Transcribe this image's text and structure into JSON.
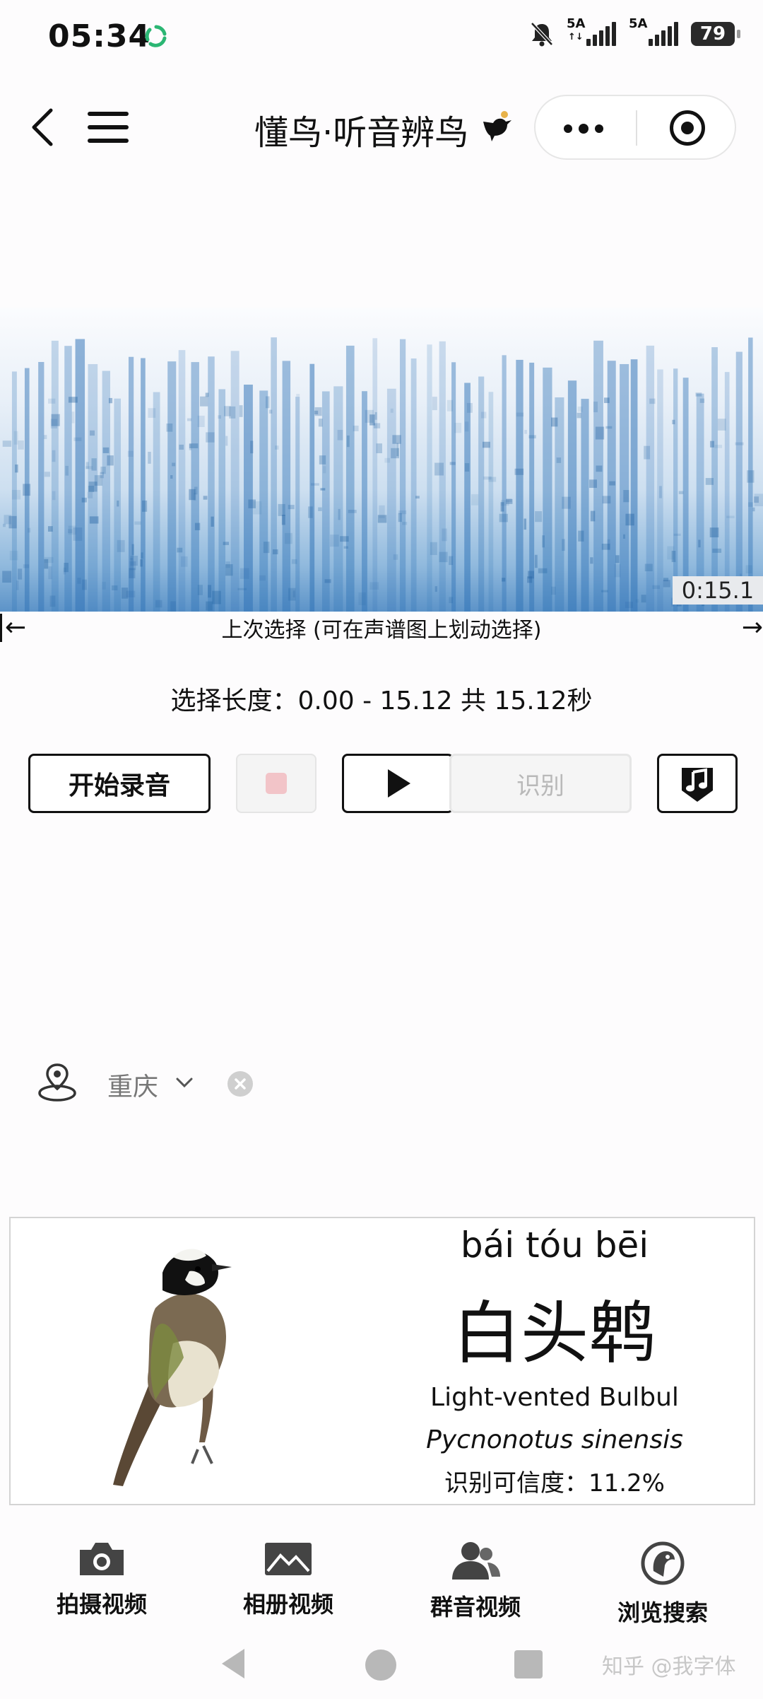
{
  "status_bar": {
    "time": "05:34",
    "sync_icon": "sync-icon",
    "mute_icon": "bell-off-icon",
    "signal_1_label": "5A",
    "signal_2_label": "5A",
    "battery": "79"
  },
  "nav": {
    "back_icon": "chevron-left-icon",
    "menu_icon": "hamburger-menu-icon",
    "title": "懂鸟·听音辨鸟",
    "title_icon": "bird-icon",
    "more_icon": "more-dots-icon",
    "close_icon": "target-circle-icon"
  },
  "spectrogram": {
    "time_label": "0:15.1",
    "left_arrow": "←",
    "right_arrow": "→",
    "hint": "上次选择 (可在声谱图上划动选择)"
  },
  "selection": {
    "text": "选择长度：0.00 - 15.12 共 15.12秒"
  },
  "controls": {
    "record_label": "开始录音",
    "stop_icon": "stop-icon",
    "play_icon": "play-icon",
    "identify_label": "识别",
    "music_icon": "music-download-icon"
  },
  "location": {
    "icon": "location-pin-icon",
    "city": "重庆",
    "chevron_icon": "chevron-down-icon",
    "clear_icon": "clear-circle-icon"
  },
  "result": {
    "pinyin": "bái tóu bēi",
    "chinese_name": "白头鹎",
    "english_name": "Light-vented Bulbul",
    "scientific_name": "Pycnonotus sinensis",
    "confidence": "识别可信度：11.2%"
  },
  "tabs": [
    {
      "label": "拍摄视频",
      "icon": "camera-icon"
    },
    {
      "label": "相册视频",
      "icon": "image-icon"
    },
    {
      "label": "群音视频",
      "icon": "users-icon"
    },
    {
      "label": "浏览搜索",
      "icon": "parrot-search-icon"
    }
  ],
  "watermark": "知乎 @我字体"
}
